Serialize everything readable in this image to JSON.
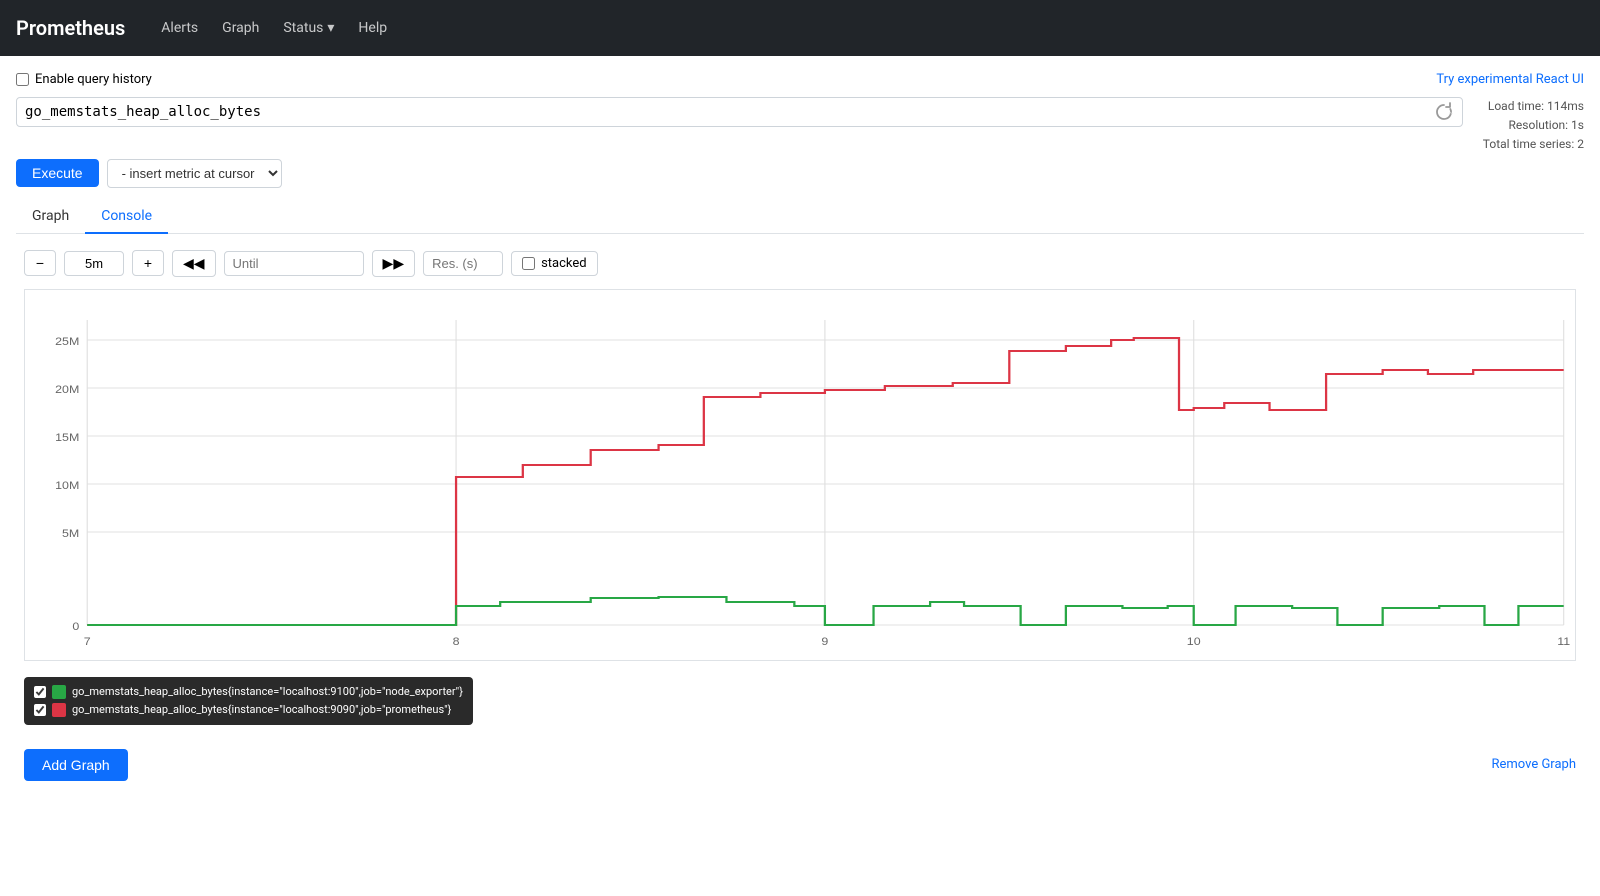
{
  "navbar": {
    "brand": "Prometheus",
    "links": [
      "Alerts",
      "Graph",
      "Help"
    ],
    "status_label": "Status",
    "status_dropdown_icon": "▾"
  },
  "topbar": {
    "enable_history_label": "Enable query history",
    "try_react_label": "Try experimental React UI"
  },
  "query": {
    "value": "go_memstats_heap_alloc_bytes",
    "placeholder": ""
  },
  "stats": {
    "load_time": "Load time: 114ms",
    "resolution": "Resolution: 1s",
    "total_series": "Total time series: 2"
  },
  "toolbar": {
    "execute_label": "Execute",
    "metric_selector_label": "- insert metric at cursor"
  },
  "tabs": [
    {
      "id": "graph",
      "label": "Graph",
      "active": false
    },
    {
      "id": "console",
      "label": "Console",
      "active": true
    }
  ],
  "graph_controls": {
    "minus_label": "−",
    "range_value": "5m",
    "plus_label": "+",
    "back_label": "◀◀",
    "until_placeholder": "Until",
    "forward_label": "▶▶",
    "res_placeholder": "Res. (s)",
    "stacked_label": "stacked"
  },
  "chart": {
    "y_labels": [
      "25M",
      "20M",
      "15M",
      "10M",
      "5M",
      "0"
    ],
    "x_labels": [
      "7",
      "8",
      "9",
      "10",
      "11"
    ],
    "accent_color": "#dc3545",
    "green_color": "#28a745"
  },
  "legend": {
    "items": [
      {
        "color": "#28a745",
        "label": "go_memstats_heap_alloc_bytes{instance=\"localhost:9100\",job=\"node_exporter\"}"
      },
      {
        "color": "#dc3545",
        "label": "go_memstats_heap_alloc_bytes{instance=\"localhost:9090\",job=\"prometheus\"}"
      }
    ]
  },
  "bottom": {
    "add_graph_label": "Add Graph",
    "remove_graph_label": "Remove Graph"
  }
}
